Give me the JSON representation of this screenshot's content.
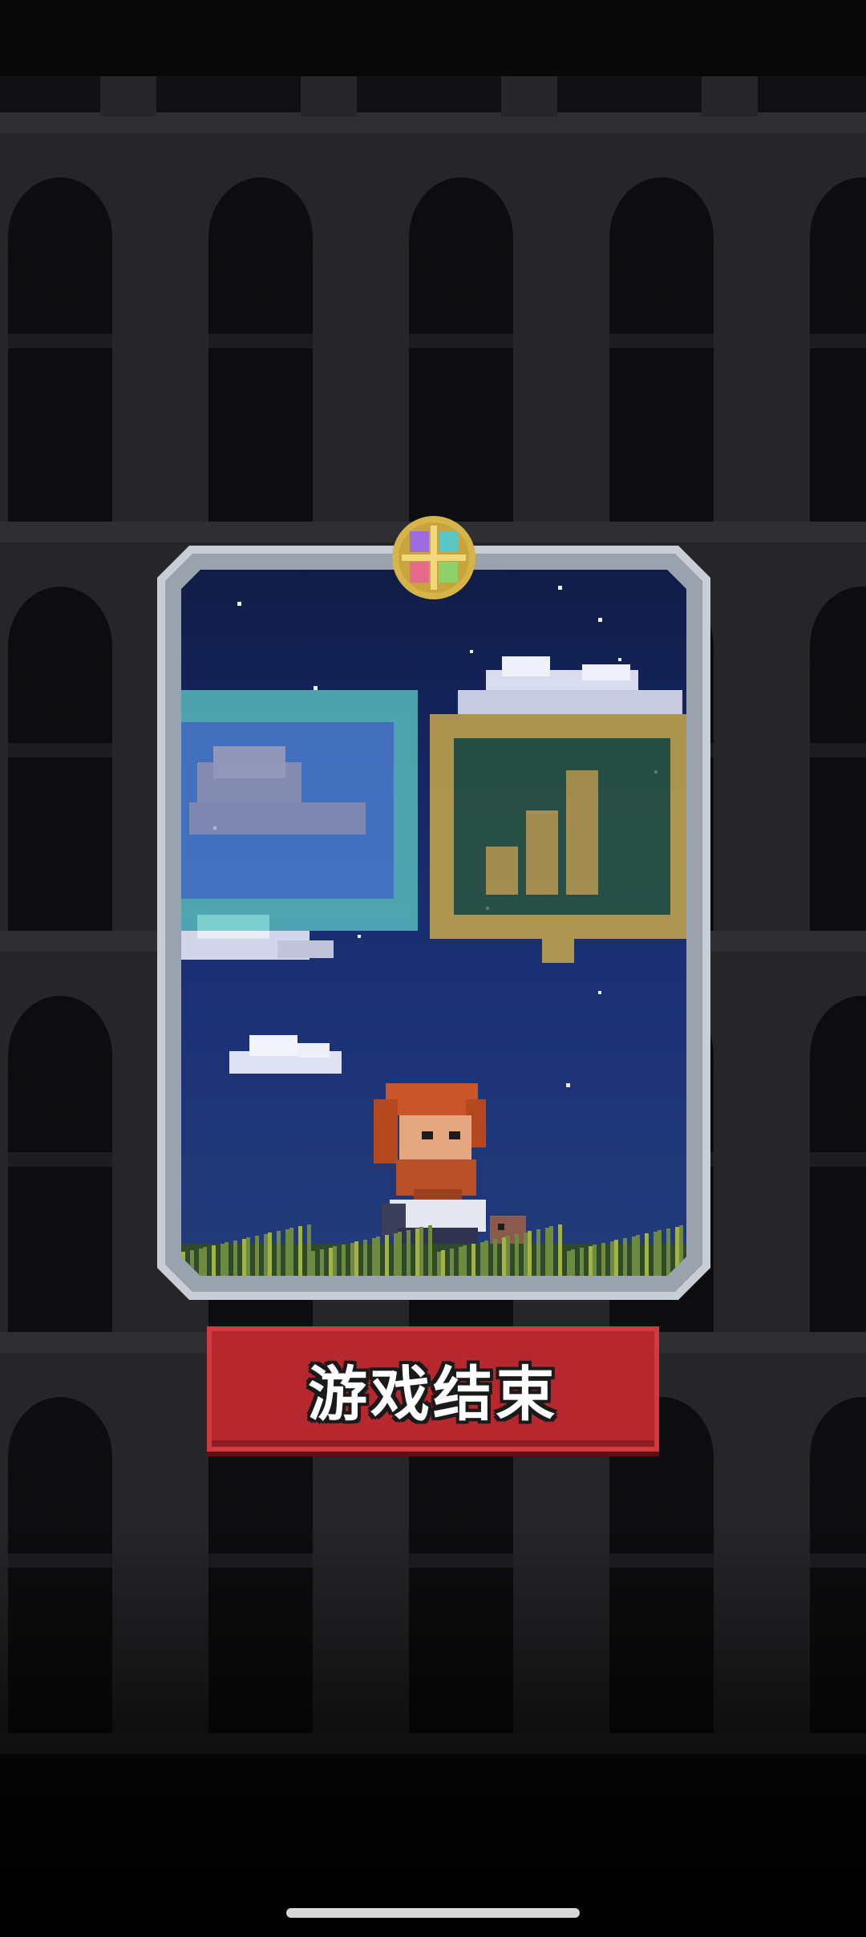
{
  "screen": {
    "background": "dark-stone-arcade",
    "title_card": {
      "scene": "night-sky-hero-in-grass",
      "emblem_icon": "four-gem-emblem-icon",
      "overlay_icons": [
        "cloud-stamp-icon",
        "chart-up-stamp-icon"
      ]
    },
    "game_over_button": {
      "label": "游戏结束",
      "color": "#b7282e"
    }
  },
  "colors": {
    "frame": "#c9ced6",
    "sky_top": "#111c46",
    "sky_bottom": "#223b7a",
    "accent_red": "#b7282e",
    "gold": "#d7b448",
    "teal": "#5ec7c3"
  }
}
